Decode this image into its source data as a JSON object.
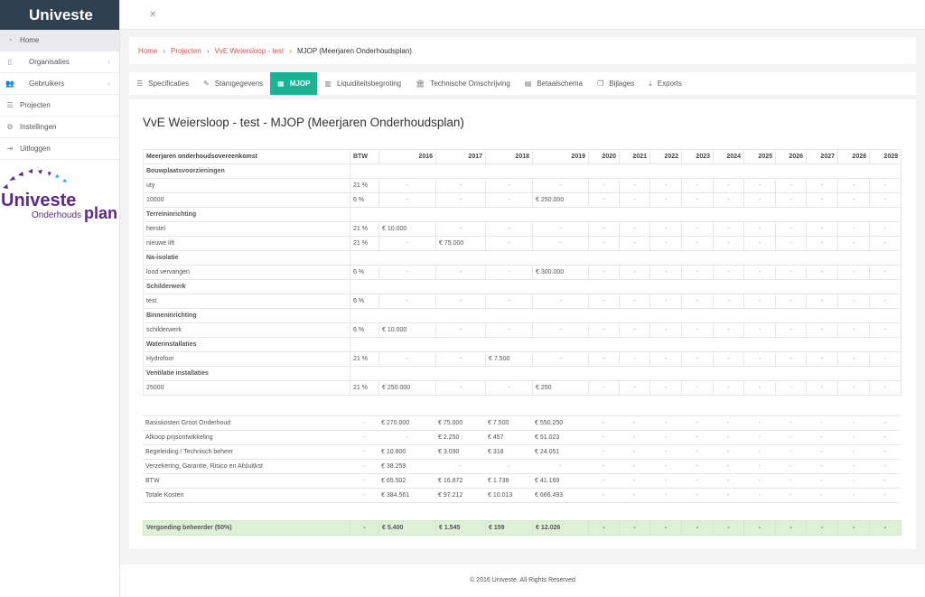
{
  "sidebar": {
    "brand": "Univeste",
    "items": [
      {
        "label": "Home",
        "icon": "dashboard-icon",
        "active": true,
        "caret": false
      },
      {
        "label": "Organisaties",
        "icon": "building-icon",
        "active": false,
        "caret": true
      },
      {
        "label": "Gebruikers",
        "icon": "users-icon",
        "active": false,
        "caret": true
      },
      {
        "label": "Projecten",
        "icon": "list-icon",
        "active": false,
        "caret": false
      },
      {
        "label": "Instellingen",
        "icon": "gear-icon",
        "active": false,
        "caret": false
      },
      {
        "label": "Uitloggen",
        "icon": "logout-icon",
        "active": false,
        "caret": false
      }
    ],
    "logo": {
      "word1": "Univeste",
      "word2": "Onderhouds",
      "word3": "plan"
    }
  },
  "breadcrumb": {
    "items": [
      "Home",
      "Projecten",
      "VvE Weiersloop - test"
    ],
    "current": "MJOP (Meerjaren Onderhoudsplan)"
  },
  "tabs": [
    {
      "label": "Specificaties",
      "icon": "list-icon",
      "active": false
    },
    {
      "label": "Stamgegevens",
      "icon": "pencil-icon",
      "active": false
    },
    {
      "label": "MJOP",
      "icon": "calendar-icon",
      "active": true
    },
    {
      "label": "Liquiditeitsbegroting",
      "icon": "bar-chart-icon",
      "active": false
    },
    {
      "label": "Technische Omschrijving",
      "icon": "bank-icon",
      "active": false
    },
    {
      "label": "Betaalschema",
      "icon": "money-icon",
      "active": false
    },
    {
      "label": "Bijlages",
      "icon": "copy-icon",
      "active": false
    },
    {
      "label": "Exports",
      "icon": "download-icon",
      "active": false
    }
  ],
  "main": {
    "title": "VvE Weiersloop - test - MJOP (Meerjaren Onderhoudsplan)",
    "table": {
      "headers": [
        "Meerjaren onderhoudsovereenkomst",
        "BTW",
        "2016",
        "2017",
        "2018",
        "2019",
        "2020",
        "2021",
        "2022",
        "2023",
        "2024",
        "2025",
        "2026",
        "2027",
        "2028",
        "2029"
      ],
      "rows": [
        {
          "type": "group",
          "cells": [
            "Bouwplaatsvoorzieningen"
          ]
        },
        {
          "type": "item",
          "cells": [
            "uty",
            "21 %",
            "-",
            "-",
            "-",
            "-",
            "-",
            "-",
            "-",
            "-",
            "-",
            "-",
            "-",
            "-",
            "-",
            "-"
          ]
        },
        {
          "type": "item",
          "cells": [
            "10000",
            "6 %",
            "-",
            "-",
            "-",
            "€ 250.000",
            "-",
            "-",
            "-",
            "-",
            "-",
            "-",
            "-",
            "-",
            "-",
            "-"
          ]
        },
        {
          "type": "group",
          "cells": [
            "Terreininrichting"
          ]
        },
        {
          "type": "item",
          "cells": [
            "herstel",
            "21 %",
            "€ 10.000",
            "-",
            "-",
            "-",
            "-",
            "-",
            "-",
            "-",
            "-",
            "-",
            "-",
            "-",
            "-",
            "-"
          ]
        },
        {
          "type": "item",
          "cells": [
            "nieuwe lift",
            "21 %",
            "-",
            "€ 75.000",
            "-",
            "-",
            "-",
            "-",
            "-",
            "-",
            "-",
            "-",
            "-",
            "-",
            "-",
            "-"
          ]
        },
        {
          "type": "group",
          "cells": [
            "Na-isolatie"
          ]
        },
        {
          "type": "item",
          "cells": [
            "lood vervangen",
            "6 %",
            "-",
            "-",
            "-",
            "€ 300.000",
            "-",
            "-",
            "-",
            "-",
            "-",
            "-",
            "-",
            "-",
            "-",
            "-"
          ]
        },
        {
          "type": "group",
          "cells": [
            "Schilderwerk"
          ]
        },
        {
          "type": "item",
          "cells": [
            "test",
            "6 %",
            "-",
            "-",
            "-",
            "-",
            "-",
            "-",
            "-",
            "-",
            "-",
            "-",
            "-",
            "-",
            "-",
            "-"
          ]
        },
        {
          "type": "group",
          "cells": [
            "Binneninrichting"
          ]
        },
        {
          "type": "item",
          "cells": [
            "schilderwerk",
            "6 %",
            "€ 10.000",
            "-",
            "-",
            "-",
            "-",
            "-",
            "-",
            "-",
            "-",
            "-",
            "-",
            "-",
            "-",
            "-"
          ]
        },
        {
          "type": "group",
          "cells": [
            "Waterinstallaties"
          ]
        },
        {
          "type": "item",
          "cells": [
            "Hydrofoor",
            "21 %",
            "-",
            "-",
            "€ 7.500",
            "-",
            "-",
            "-",
            "-",
            "-",
            "-",
            "-",
            "-",
            "-",
            "-",
            "-"
          ]
        },
        {
          "type": "group",
          "cells": [
            "Ventilatie installaties"
          ]
        },
        {
          "type": "item",
          "cells": [
            "25000",
            "21 %",
            "€ 250.000",
            "-",
            "-",
            "€ 250",
            "-",
            "-",
            "-",
            "-",
            "-",
            "-",
            "-",
            "-",
            "-",
            "-"
          ]
        }
      ]
    },
    "summary": [
      [
        "Basiskosten Groot Onderhoud",
        "-",
        "€ 270.000",
        "€ 75.000",
        "€ 7.500",
        "€ 550.250",
        "-",
        "-",
        "-",
        "-",
        "-",
        "-",
        "-",
        "-",
        "-",
        "-"
      ],
      [
        "Afkoop prijsontwikkeling",
        "-",
        "-",
        "€ 2.250",
        "€ 457",
        "€ 51.023",
        "-",
        "-",
        "-",
        "-",
        "-",
        "-",
        "-",
        "-",
        "-",
        "-"
      ],
      [
        "Begeleiding / Technisch beheer",
        "-",
        "€ 10.800",
        "€ 3.090",
        "€ 318",
        "€ 24.051",
        "-",
        "-",
        "-",
        "-",
        "-",
        "-",
        "-",
        "-",
        "-",
        "-"
      ],
      [
        "Verzekering, Garantie, Risico en Afsluitkst",
        "-",
        "€ 38.259",
        "-",
        "-",
        "-",
        "-",
        "-",
        "-",
        "-",
        "-",
        "-",
        "-",
        "-",
        "-",
        "-"
      ],
      [
        "BTW",
        "-",
        "€ 65.502",
        "€ 16.872",
        "€ 1.738",
        "€ 41.169",
        "-",
        "-",
        "-",
        "-",
        "-",
        "-",
        "-",
        "-",
        "-",
        "-"
      ],
      [
        "Totale Kosten",
        "-",
        "€ 384.561",
        "€ 97.212",
        "€ 10.013",
        "€ 666.493",
        "-",
        "-",
        "-",
        "-",
        "-",
        "-",
        "-",
        "-",
        "-",
        "-"
      ]
    ],
    "vergoeding": [
      "Vergoeding beheerder (50%)",
      "-",
      "€ 5.400",
      "€ 1.545",
      "€ 159",
      "€ 12.026",
      "-",
      "-",
      "-",
      "-",
      "-",
      "-",
      "-",
      "-",
      "-",
      "-"
    ]
  },
  "footer": "© 2016 Univeste. All Rights Reserved",
  "colors": {
    "accent": "#1ab394",
    "brand": "#2f4050",
    "link": "#d9534f",
    "logo_purple": "#5b2a86",
    "logo_blue": "#29a8e0"
  }
}
